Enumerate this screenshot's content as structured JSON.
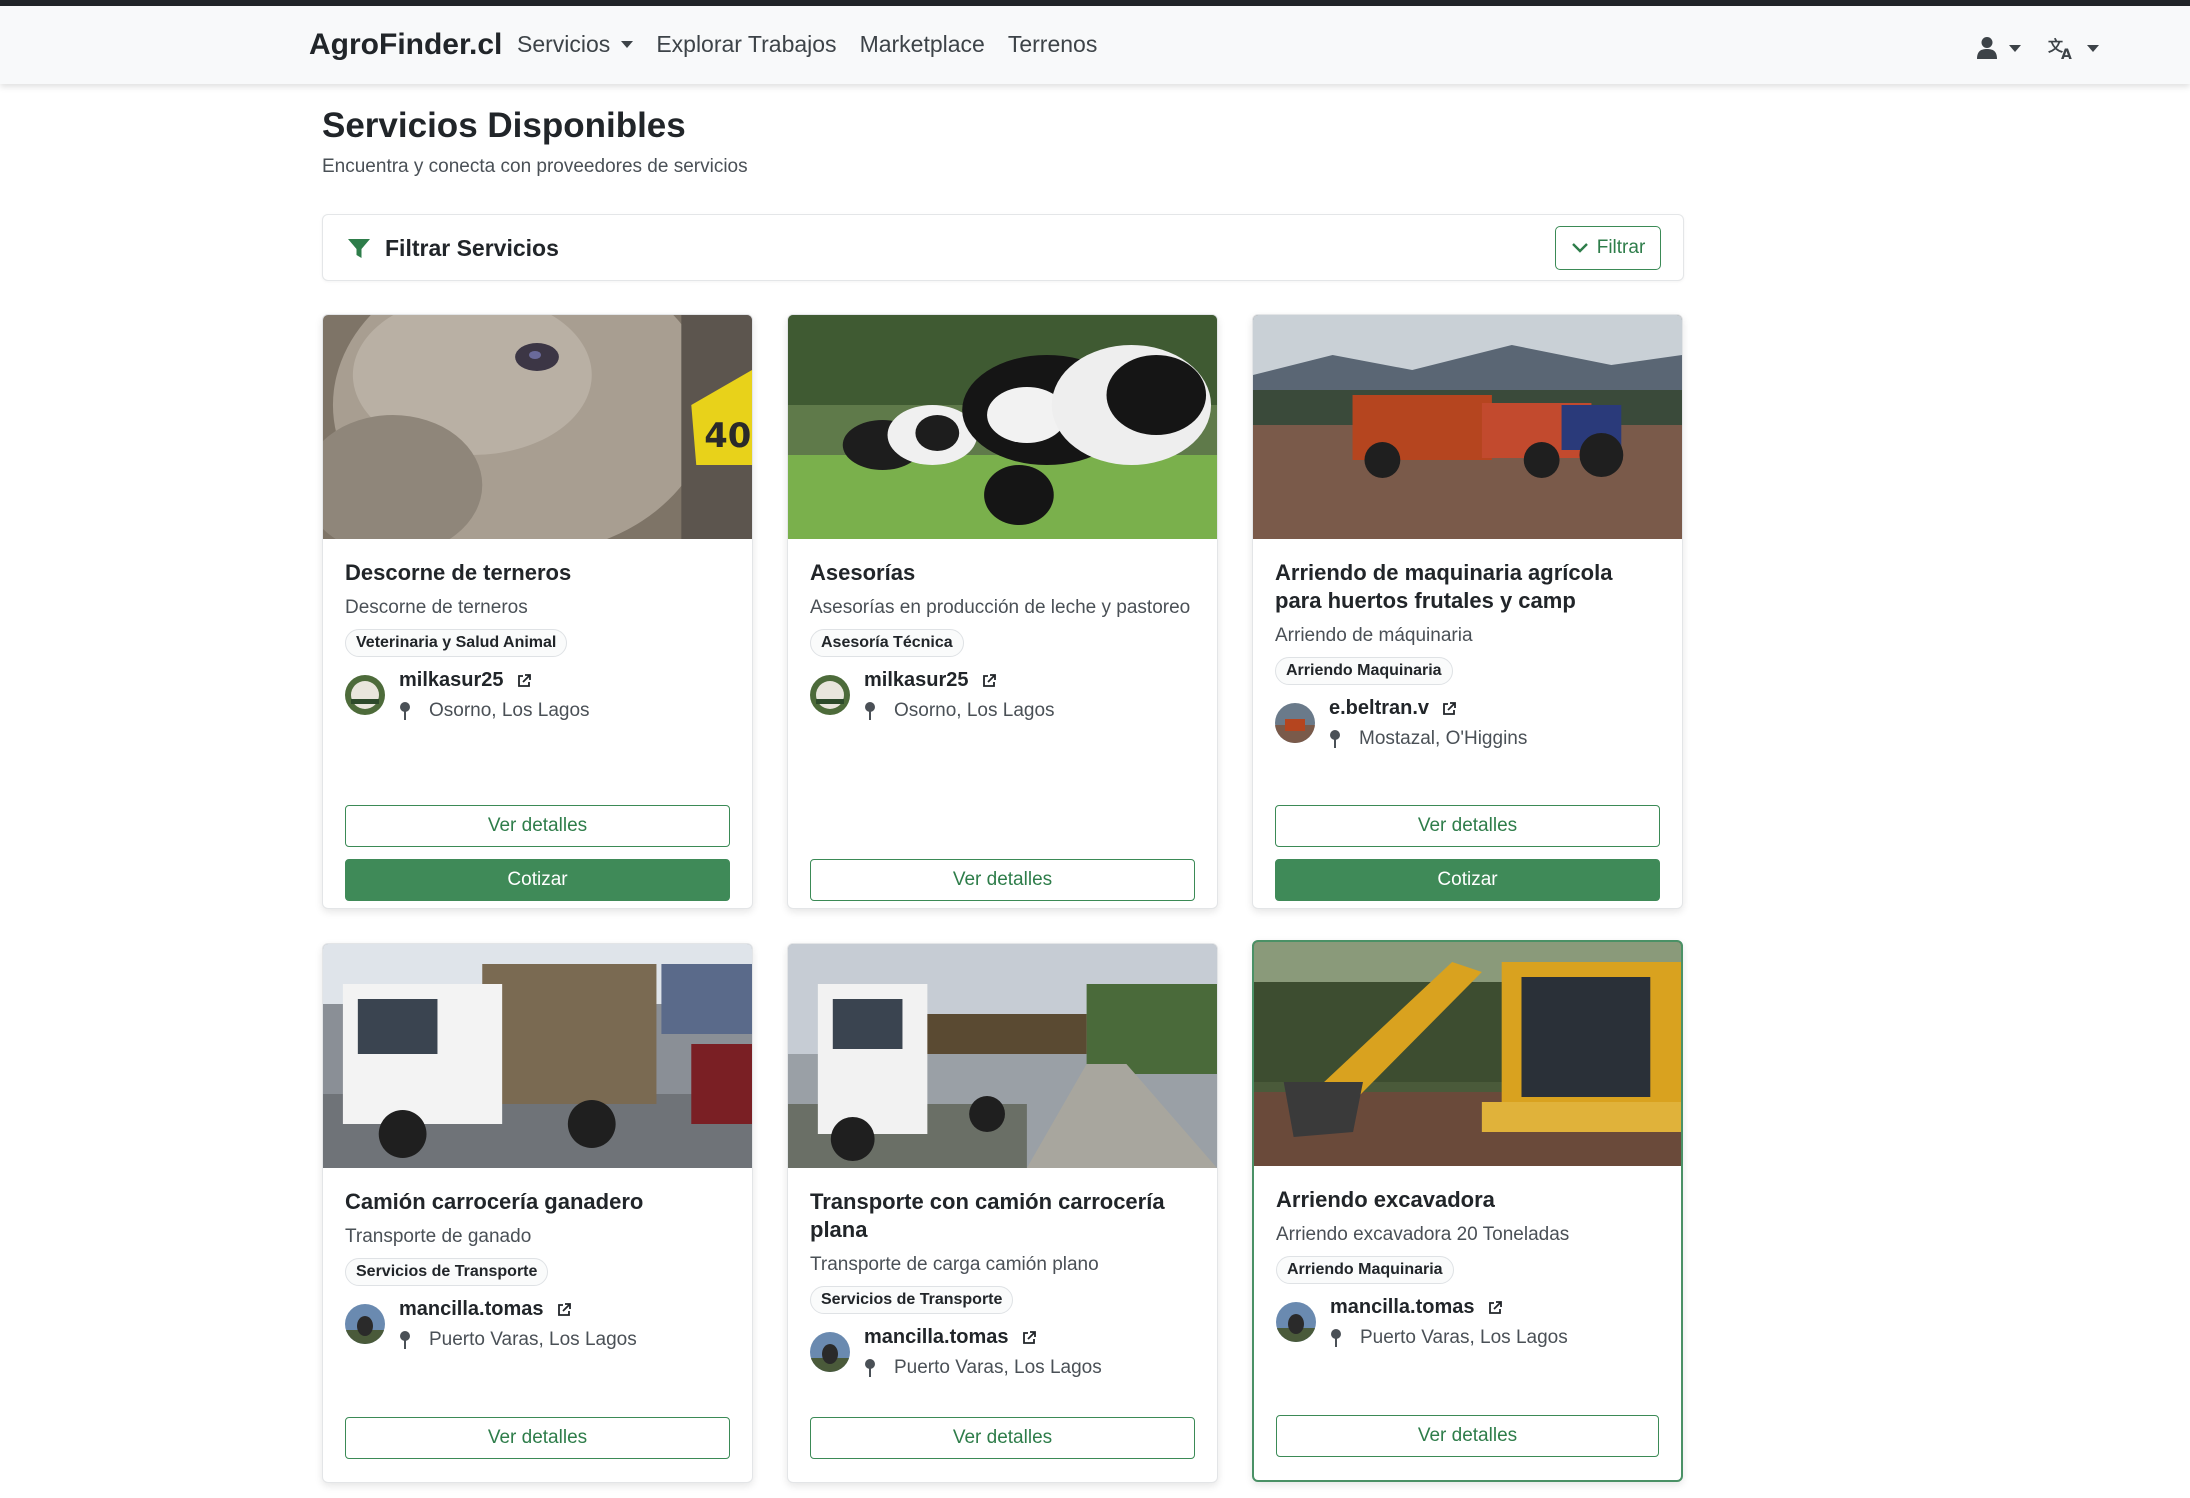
{
  "nav": {
    "brand": "AgroFinder.cl",
    "items": [
      {
        "label": "Servicios",
        "dropdown": true
      },
      {
        "label": "Explorar Trabajos"
      },
      {
        "label": "Marketplace"
      },
      {
        "label": "Terrenos"
      }
    ],
    "user_icon": "user-icon",
    "lang_icon": "translate-icon"
  },
  "page": {
    "title": "Servicios Disponibles",
    "subtitle": "Encuentra y conecta con proveedores de servicios"
  },
  "filter": {
    "title": "Filtrar Servicios",
    "button_label": "Filtrar"
  },
  "colors": {
    "accent": "#3f8a58",
    "text": "#212529"
  },
  "services": [
    {
      "title": "Descorne de terneros",
      "description": "Descorne de terneros",
      "category": "Veterinaria y Salud Animal",
      "provider": "milkasur25",
      "location": "Osorno, Los Lagos",
      "image": "calf-closeup",
      "details_label": "Ver detalles",
      "quote_label": "Cotizar"
    },
    {
      "title": "Asesorías",
      "description": "Asesorías en producción de leche y pastoreo",
      "category": "Asesoría Técnica",
      "provider": "milkasur25",
      "location": "Osorno, Los Lagos",
      "image": "cows-grazing",
      "details_label": "Ver detalles"
    },
    {
      "title": "Arriendo de maquinaria agrícola para huertos frutales y camp",
      "description": "Arriendo de máquinaria",
      "category": "Arriendo Maquinaria",
      "provider": "e.beltran.v",
      "location": "Mostazal, O'Higgins",
      "image": "tractor-trailer",
      "details_label": "Ver detalles",
      "quote_label": "Cotizar"
    },
    {
      "title": "Camión carrocería ganadero",
      "description": "Transporte de ganado",
      "category": "Servicios de Transporte",
      "provider": "mancilla.tomas",
      "location": "Puerto Varas, Los Lagos",
      "image": "livestock-truck",
      "details_label": "Ver detalles"
    },
    {
      "title": "Transporte con camión carrocería plana",
      "description": "Transporte de carga camión plano",
      "category": "Servicios de Transporte",
      "provider": "mancilla.tomas",
      "location": "Puerto Varas, Los Lagos",
      "image": "flatbed-truck",
      "details_label": "Ver detalles"
    },
    {
      "title": "Arriendo excavadora",
      "description": "Arriendo excavadora 20 Toneladas",
      "category": "Arriendo Maquinaria",
      "provider": "mancilla.tomas",
      "location": "Puerto Varas, Los Lagos",
      "image": "excavator",
      "details_label": "Ver detalles"
    }
  ]
}
